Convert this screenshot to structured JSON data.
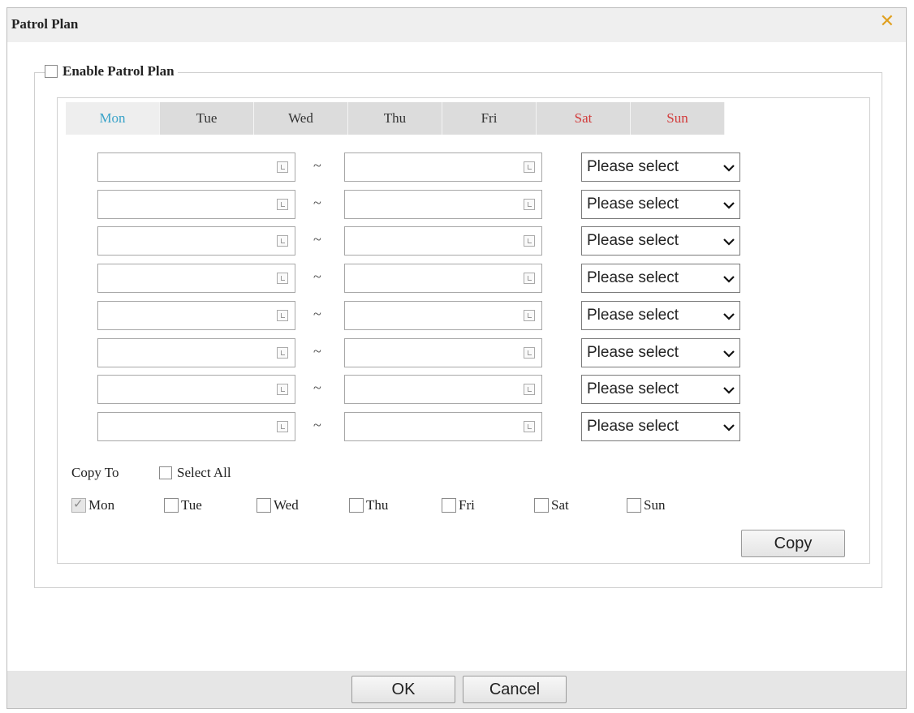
{
  "dialog": {
    "title": "Patrol Plan",
    "close_icon": "close-icon",
    "accent_close": "#e0a020"
  },
  "enable": {
    "label": "Enable Patrol Plan",
    "checked": false
  },
  "tabs": [
    {
      "label": "Mon",
      "active": true
    },
    {
      "label": "Tue"
    },
    {
      "label": "Wed"
    },
    {
      "label": "Thu"
    },
    {
      "label": "Fri"
    },
    {
      "label": "Sat",
      "weekend": true
    },
    {
      "label": "Sun",
      "weekend": true
    }
  ],
  "schedule": {
    "separator": "~",
    "select_placeholder": "Please select",
    "rows": [
      {
        "start": "",
        "end": ""
      },
      {
        "start": "",
        "end": ""
      },
      {
        "start": "",
        "end": ""
      },
      {
        "start": "",
        "end": ""
      },
      {
        "start": "",
        "end": ""
      },
      {
        "start": "",
        "end": ""
      },
      {
        "start": "",
        "end": ""
      },
      {
        "start": "",
        "end": ""
      }
    ]
  },
  "copy": {
    "label": "Copy To",
    "select_all": "Select All",
    "days": [
      {
        "label": "Mon",
        "checked": true
      },
      {
        "label": "Tue",
        "checked": false
      },
      {
        "label": "Wed",
        "checked": false
      },
      {
        "label": "Thu",
        "checked": false
      },
      {
        "label": "Fri",
        "checked": false
      },
      {
        "label": "Sat",
        "checked": false
      },
      {
        "label": "Sun",
        "checked": false
      }
    ],
    "button": "Copy"
  },
  "footer": {
    "ok": "OK",
    "cancel": "Cancel"
  },
  "colors": {
    "active_tab_text": "#3aa3c9",
    "weekend_text": "#d23a3a"
  }
}
